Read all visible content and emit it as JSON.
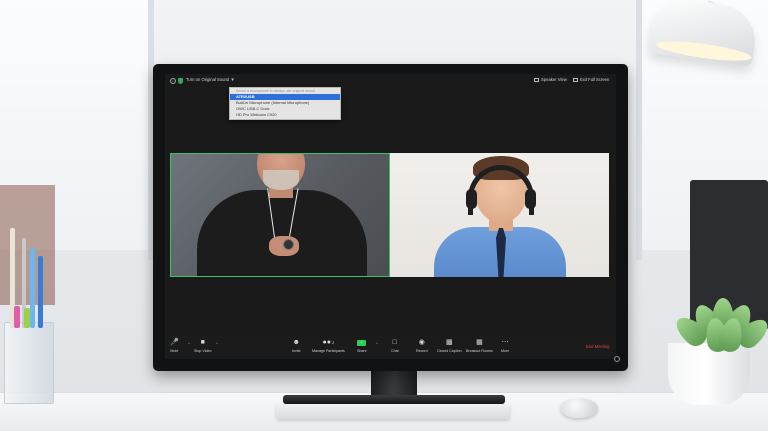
{
  "topbar": {
    "original_sound_label": "Turn on Original Sound",
    "speaker_view_label": "Speaker View",
    "exit_fullscreen_label": "Exit Full Screen"
  },
  "microphone_menu": {
    "header": "Select a microphone to always use original sound",
    "items": [
      {
        "label": "ATR2USB",
        "selected": true
      },
      {
        "label": "Built-in Microphone (Internal Microphone)",
        "selected": false
      },
      {
        "label": "OWC USB-C Dock",
        "selected": false
      },
      {
        "label": "HD Pro Webcam C920",
        "selected": false
      }
    ]
  },
  "toolbar": {
    "mute_label": "Mute",
    "stop_video_label": "Stop Video",
    "invite_label": "Invite",
    "participants_label": "Manage Participants",
    "participants_count": "2",
    "share_label": "Share",
    "chat_label": "Chat",
    "record_label": "Record",
    "closed_caption_label": "Closed Caption",
    "breakout_rooms_label": "Breakout Rooms",
    "more_label": "More",
    "end_meeting_label": "End Meeting"
  },
  "colors": {
    "active_speaker_border": "#34c36b",
    "share_green": "#2ecc57",
    "end_meeting_red": "#e0473e",
    "menu_highlight": "#2f6fdc"
  },
  "icons": [
    "info-icon",
    "shield-icon",
    "chevron-down-icon",
    "speaker-view-icon",
    "exit-fullscreen-icon",
    "microphone-icon",
    "video-camera-icon",
    "invite-icon",
    "participants-icon",
    "share-screen-icon",
    "chat-icon",
    "record-icon",
    "closed-caption-icon",
    "breakout-rooms-icon",
    "more-icon",
    "fullscreen-icon"
  ]
}
